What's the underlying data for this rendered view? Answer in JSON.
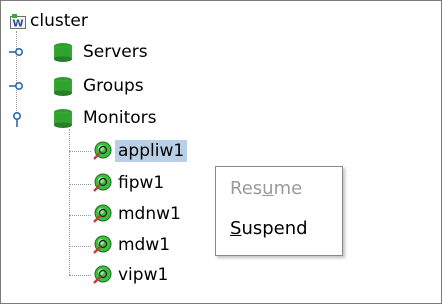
{
  "tree": {
    "root": {
      "label": "cluster",
      "icon": "cluster-icon"
    },
    "groups": [
      {
        "label": "Servers",
        "icon": "folder-icon",
        "expanded": false
      },
      {
        "label": "Groups",
        "icon": "folder-icon",
        "expanded": false
      },
      {
        "label": "Monitors",
        "icon": "folder-icon",
        "expanded": true
      }
    ],
    "monitors": [
      {
        "label": "appliw1",
        "icon": "monitor-status-icon",
        "selected": true
      },
      {
        "label": "fipw1",
        "icon": "monitor-status-icon",
        "selected": false
      },
      {
        "label": "mdnw1",
        "icon": "monitor-status-icon",
        "selected": false
      },
      {
        "label": "mdw1",
        "icon": "monitor-status-icon",
        "selected": false
      },
      {
        "label": "vipw1",
        "icon": "monitor-status-icon",
        "selected": false
      }
    ]
  },
  "context_menu": {
    "items": [
      {
        "label": "Resume",
        "mnemonic": "u",
        "enabled": false
      },
      {
        "label": "Suspend",
        "mnemonic": "S",
        "enabled": true
      }
    ]
  },
  "colors": {
    "selection": "#b8cfe5",
    "folder_green": "#2e9e2e",
    "monitor_green": "#3cbf3c",
    "disabled_text": "#9a9a9a"
  }
}
